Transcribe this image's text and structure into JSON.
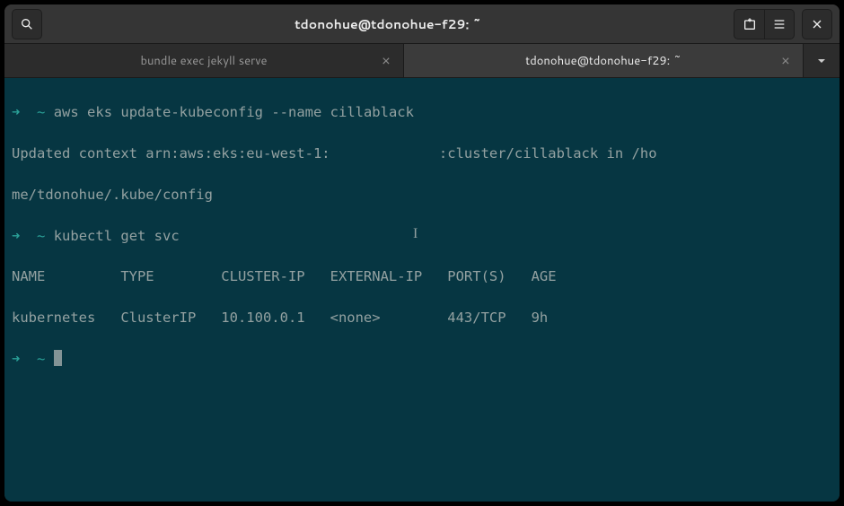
{
  "titlebar": {
    "title": "tdonohue@tdonohue-f29: ~"
  },
  "tabs": [
    {
      "label": "bundle exec jekyll serve",
      "active": false
    },
    {
      "label": "tdonohue@tdonohue-f29: ~",
      "active": true
    }
  ],
  "terminal": {
    "lines": [
      {
        "prompt": "➜",
        "path": "~",
        "cmd": "aws eks update-kubeconfig --name cillablack"
      },
      {
        "text": "Updated context arn:aws:eks:eu-west-1:             :cluster/cillablack in /ho"
      },
      {
        "text": "me/tdonohue/.kube/config"
      },
      {
        "prompt": "➜",
        "path": "~",
        "cmd": "kubectl get svc"
      },
      {
        "text": "NAME         TYPE        CLUSTER-IP   EXTERNAL-IP   PORT(S)   AGE"
      },
      {
        "text": "kubernetes   ClusterIP   10.100.0.1   <none>        443/TCP   9h"
      },
      {
        "prompt": "➜",
        "path": "~",
        "cmd": "",
        "cursor": true
      }
    ]
  }
}
